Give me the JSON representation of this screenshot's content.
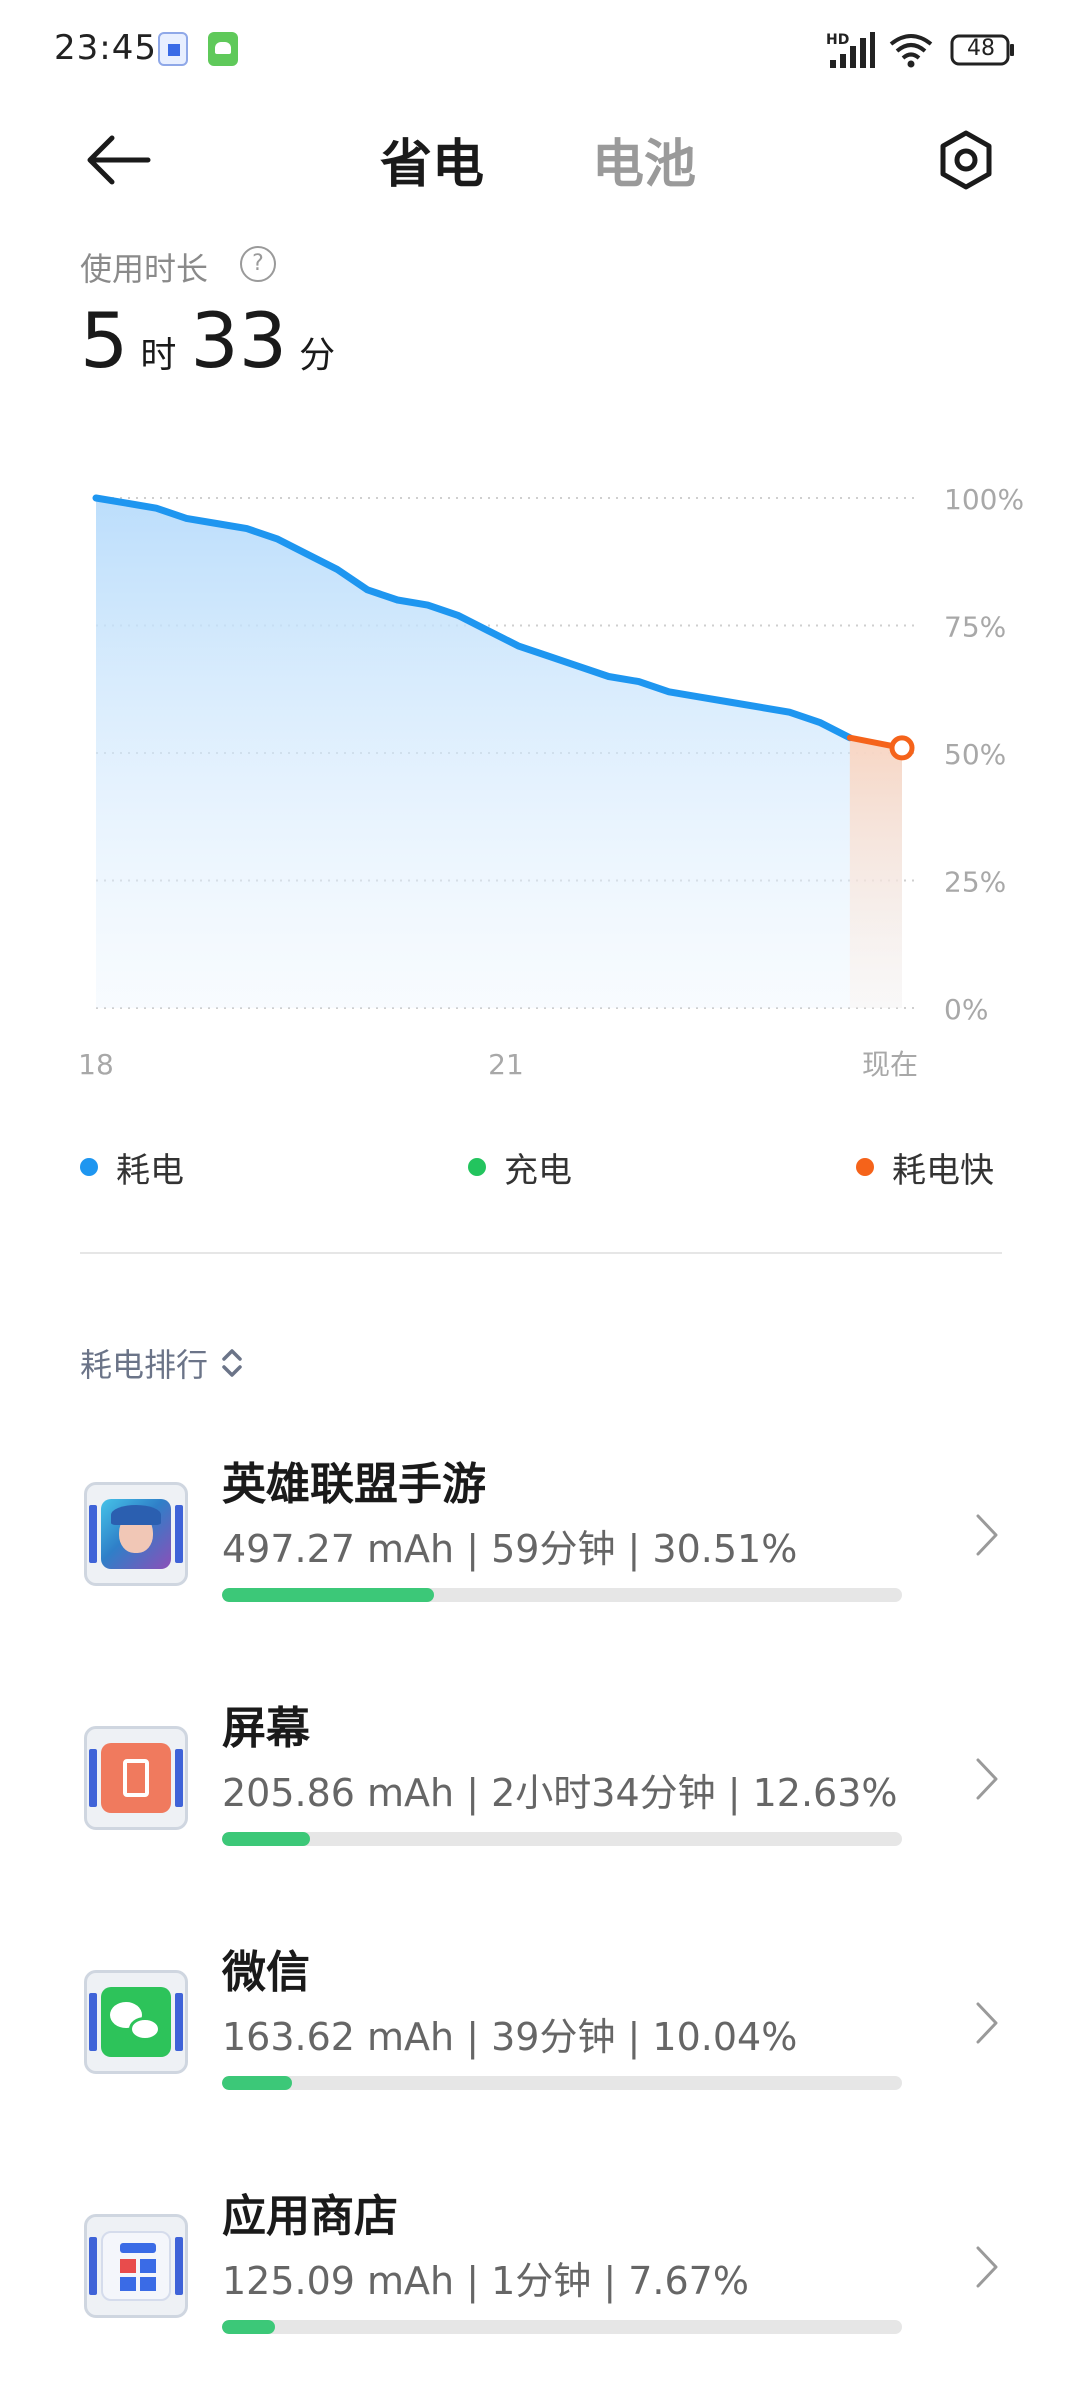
{
  "status_bar": {
    "time": "23:45",
    "network": "HD",
    "battery_level": "48"
  },
  "header": {
    "tabs": [
      {
        "label": "省电",
        "active": true
      },
      {
        "label": "电池",
        "active": false
      }
    ]
  },
  "usage": {
    "label": "使用时长",
    "hours": "5",
    "hours_unit": "时",
    "minutes": "33",
    "minutes_unit": "分"
  },
  "chart_data": {
    "type": "area",
    "x_tick_labels": [
      "18",
      "21",
      "现在"
    ],
    "y_tick_labels": [
      "100%",
      "75%",
      "50%",
      "25%",
      "0%"
    ],
    "ylim": [
      0,
      100
    ],
    "grid": true,
    "series": [
      {
        "name": "耗电",
        "color": "#1e96f0",
        "values": [
          100,
          99,
          98,
          96,
          95,
          94,
          92,
          89,
          86,
          82,
          80,
          79,
          77,
          74,
          71,
          69,
          67,
          65,
          64,
          62,
          61,
          60,
          59,
          58,
          56,
          53
        ]
      }
    ],
    "fast_drain_marker": {
      "value": 51,
      "color": "#f5631a"
    }
  },
  "legend": [
    {
      "label": "耗电",
      "color": "#1e96f0"
    },
    {
      "label": "充电",
      "color": "#23c45e"
    },
    {
      "label": "耗电快",
      "color": "#f5631a"
    }
  ],
  "ranking": {
    "title": "耗电排行",
    "apps": [
      {
        "name": "英雄联盟手游",
        "stats": "497.27 mAh | 59分钟 | 30.51%",
        "percent": 30.51,
        "icon": "lol-game-icon"
      },
      {
        "name": "屏幕",
        "stats": "205.86 mAh | 2小时34分钟 | 12.63%",
        "percent": 12.63,
        "icon": "screen-icon"
      },
      {
        "name": "微信",
        "stats": "163.62 mAh | 39分钟 | 10.04%",
        "percent": 10.04,
        "icon": "wechat-icon"
      },
      {
        "name": "应用商店",
        "stats": "125.09 mAh | 1分钟 | 7.67%",
        "percent": 7.67,
        "icon": "app-store-icon"
      }
    ]
  }
}
